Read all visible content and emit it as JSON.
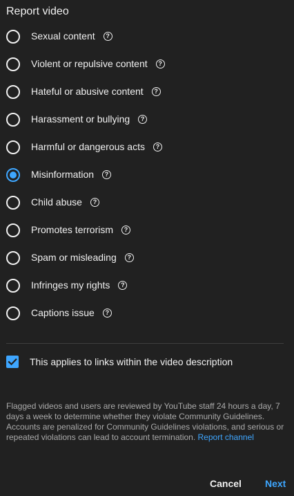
{
  "dialog": {
    "title": "Report video"
  },
  "options": [
    {
      "label": "Sexual content",
      "selected": false
    },
    {
      "label": "Violent or repulsive content",
      "selected": false
    },
    {
      "label": "Hateful or abusive content",
      "selected": false
    },
    {
      "label": "Harassment or bullying",
      "selected": false
    },
    {
      "label": "Harmful or dangerous acts",
      "selected": false
    },
    {
      "label": "Misinformation",
      "selected": true
    },
    {
      "label": "Child abuse",
      "selected": false
    },
    {
      "label": "Promotes terrorism",
      "selected": false
    },
    {
      "label": "Spam or misleading",
      "selected": false
    },
    {
      "label": "Infringes my rights",
      "selected": false
    },
    {
      "label": "Captions issue",
      "selected": false
    }
  ],
  "help_icon_glyph": "?",
  "links_checkbox": {
    "label": "This applies to links within the video description",
    "checked": true
  },
  "disclaimer": {
    "text": "Flagged videos and users are reviewed by YouTube staff 24 hours a day, 7 days a week to determine whether they violate Community Guidelines. Accounts are penalized for Community Guidelines violations, and serious or repeated violations can lead to account termination.",
    "link": "Report channel"
  },
  "footer": {
    "cancel_label": "Cancel",
    "next_label": "Next"
  },
  "colors": {
    "background": "#212121",
    "text": "#f1f1f1",
    "accent": "#3ea6ff",
    "muted_text": "#aaaaaa",
    "divider": "#3f3f3f"
  }
}
